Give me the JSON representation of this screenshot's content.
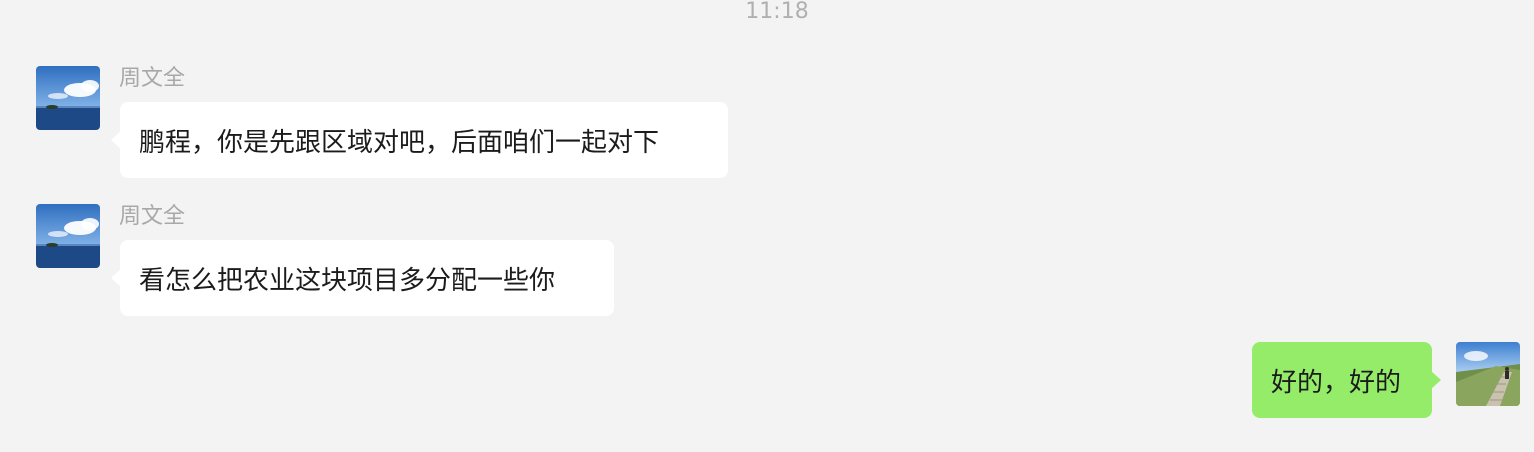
{
  "timestamp": "11:18",
  "messages": [
    {
      "sender": "周文全",
      "text": "鹏程，你是先跟区域对吧，后面咱们一起对下",
      "direction": "incoming",
      "avatar": "sea-sky-avatar"
    },
    {
      "sender": "周文全",
      "text": "看怎么把农业这块项目多分配一些你",
      "direction": "incoming",
      "avatar": "sea-sky-avatar"
    },
    {
      "sender": "",
      "text": "好的，好的",
      "direction": "outgoing",
      "avatar": "hiking-stairs-avatar"
    }
  ],
  "colors": {
    "background": "#f3f3f3",
    "incoming_bubble": "#ffffff",
    "outgoing_bubble": "#95ec69",
    "name_text": "#a8a8a8",
    "timestamp_text": "#b0b0b0"
  }
}
